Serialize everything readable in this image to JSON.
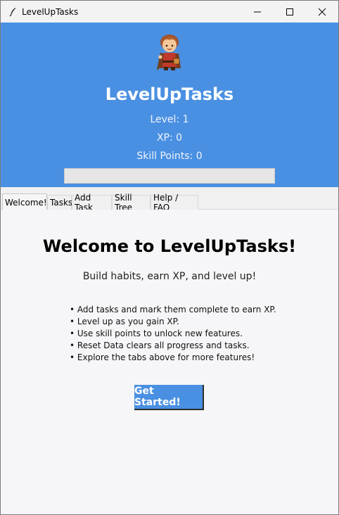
{
  "window": {
    "title": "LevelUpTasks",
    "minimize_glyph": "—",
    "maximize_glyph": "☐",
    "close_glyph": "✕"
  },
  "header": {
    "app_name": "LevelUpTasks",
    "level_text": "Level: 1",
    "xp_text": "XP: 0",
    "skill_points_text": "Skill Points: 0",
    "xp_progress": 0,
    "avatar_icon": "adventurer-avatar-icon",
    "background_color": "#4a90e2"
  },
  "tabs": [
    {
      "label": "Welcome!",
      "active": true
    },
    {
      "label": "Tasks",
      "active": false
    },
    {
      "label": "Add Task",
      "active": false
    },
    {
      "label": "Skill Tree",
      "active": false
    },
    {
      "label": "Help / FAQ",
      "active": false
    }
  ],
  "welcome": {
    "title": "Welcome to LevelUpTasks!",
    "subtitle": "Build habits, earn XP, and level up!",
    "bullets": [
      "• Add tasks and mark them complete to earn XP.",
      "• Level up as you gain XP.",
      "• Use skill points to unlock new features.",
      "• Reset Data clears all progress and tasks.",
      "• Explore the tabs above for more features!"
    ],
    "cta_label": "Get Started!"
  },
  "colors": {
    "accent": "#4a90e2",
    "content_bg": "#f6f6f8"
  }
}
